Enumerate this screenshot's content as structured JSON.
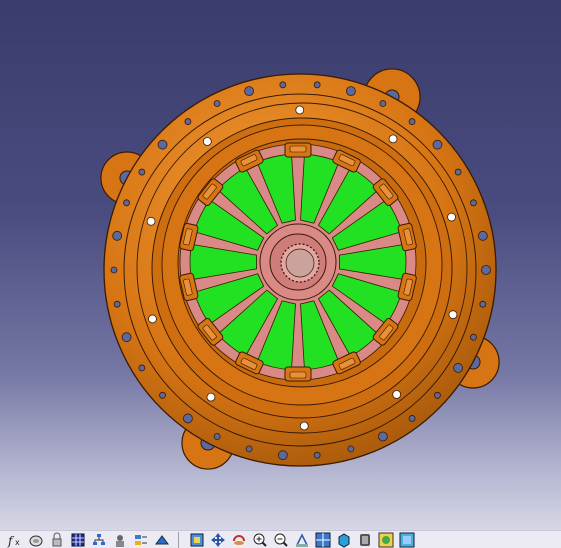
{
  "viewport": {
    "model": "clutch-pressure-plate-assembly",
    "background_top": "#3a3c6c",
    "background_bottom": "#d6d7e6"
  },
  "colors": {
    "housing": "#d77514",
    "housing_dark": "#8a4706",
    "edge_lines": "#3a1a00",
    "diaphragm_fingers": "#22e022",
    "hub": "#d98a86",
    "holes": "#5a6aa0"
  },
  "toolbar": {
    "buttons": [
      {
        "id": "formula",
        "icon": "fx-icon"
      },
      {
        "id": "catalog",
        "icon": "catalog-icon"
      },
      {
        "id": "hide-show",
        "icon": "lock-icon"
      },
      {
        "id": "table",
        "icon": "table-icon"
      },
      {
        "id": "tree",
        "icon": "tree-icon"
      },
      {
        "id": "measure",
        "icon": "measure-icon"
      },
      {
        "id": "parameters",
        "icon": "parameters-icon"
      },
      {
        "id": "fly",
        "icon": "fly-icon"
      },
      {
        "id": "fit-all",
        "icon": "fit-all-icon"
      },
      {
        "id": "pan",
        "icon": "pan-icon"
      },
      {
        "id": "rotate",
        "icon": "rotate-icon"
      },
      {
        "id": "zoom-in",
        "icon": "zoom-in-icon"
      },
      {
        "id": "zoom-out",
        "icon": "zoom-out-icon"
      },
      {
        "id": "normal-view",
        "icon": "normal-view-icon"
      },
      {
        "id": "multi-view",
        "icon": "multi-view-icon"
      },
      {
        "id": "iso-view",
        "icon": "iso-view-icon"
      },
      {
        "id": "shading",
        "icon": "shading-icon"
      },
      {
        "id": "hide",
        "icon": "hide-icon"
      },
      {
        "id": "swap",
        "icon": "swap-icon"
      }
    ]
  }
}
